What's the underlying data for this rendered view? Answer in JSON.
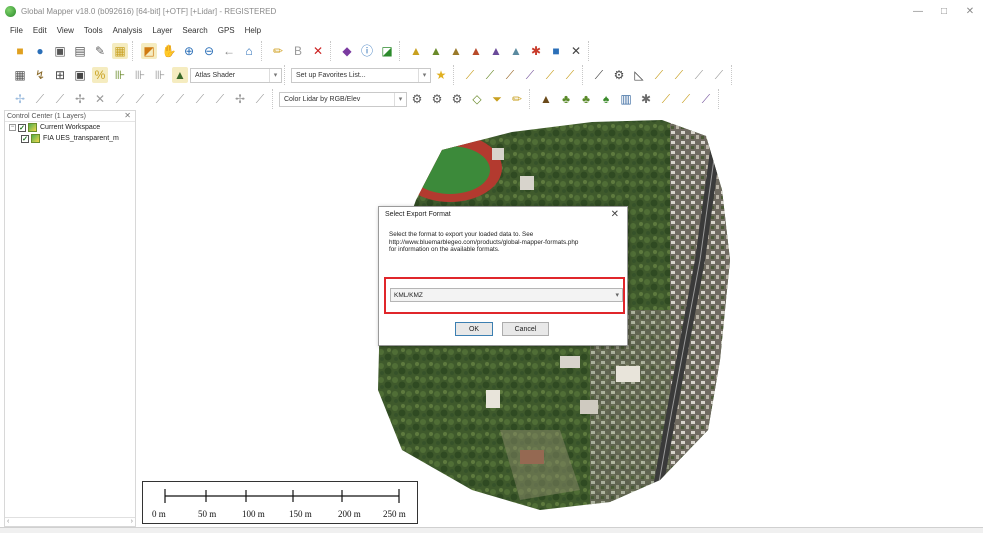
{
  "window": {
    "title": "Global Mapper v18.0 (b092616) [64-bit] [+OTF] [+Lidar] - REGISTERED",
    "controls": [
      "—",
      "□",
      "✕"
    ]
  },
  "menu": [
    "File",
    "Edit",
    "View",
    "Tools",
    "Analysis",
    "Layer",
    "Search",
    "GPS",
    "Help"
  ],
  "toolbars": {
    "shader_select": "Atlas Shader",
    "favorites_select": "Set up Favorites List...",
    "lidar_color_select": "Color Lidar by RGB/Elev"
  },
  "control_center": {
    "header": "Control Center (1 Layers)",
    "close": "✕",
    "workspace_label": "Current Workspace",
    "layer_label": "FIA UES_transparent_m"
  },
  "scale_bar": {
    "labels": [
      "0 m",
      "50 m",
      "100 m",
      "150 m",
      "200 m",
      "250 m"
    ]
  },
  "dialog": {
    "title": "Select Export Format",
    "close": "✕",
    "description_line1": "Select the format to export your loaded data to. See",
    "description_line2": "http://www.bluemarblegeo.com/products/global-mapper-formats.php",
    "description_line3": "for information on the available formats.",
    "selected_format": "KML/KMZ",
    "ok_label": "OK",
    "cancel_label": "Cancel",
    "highlight_color": "#e0262b"
  },
  "colors": {
    "accent_highlight": "#e0262b",
    "map_vegetation": "#3f5a2c",
    "track_red": "#b33a2f",
    "field_green": "#3c8a3a"
  }
}
